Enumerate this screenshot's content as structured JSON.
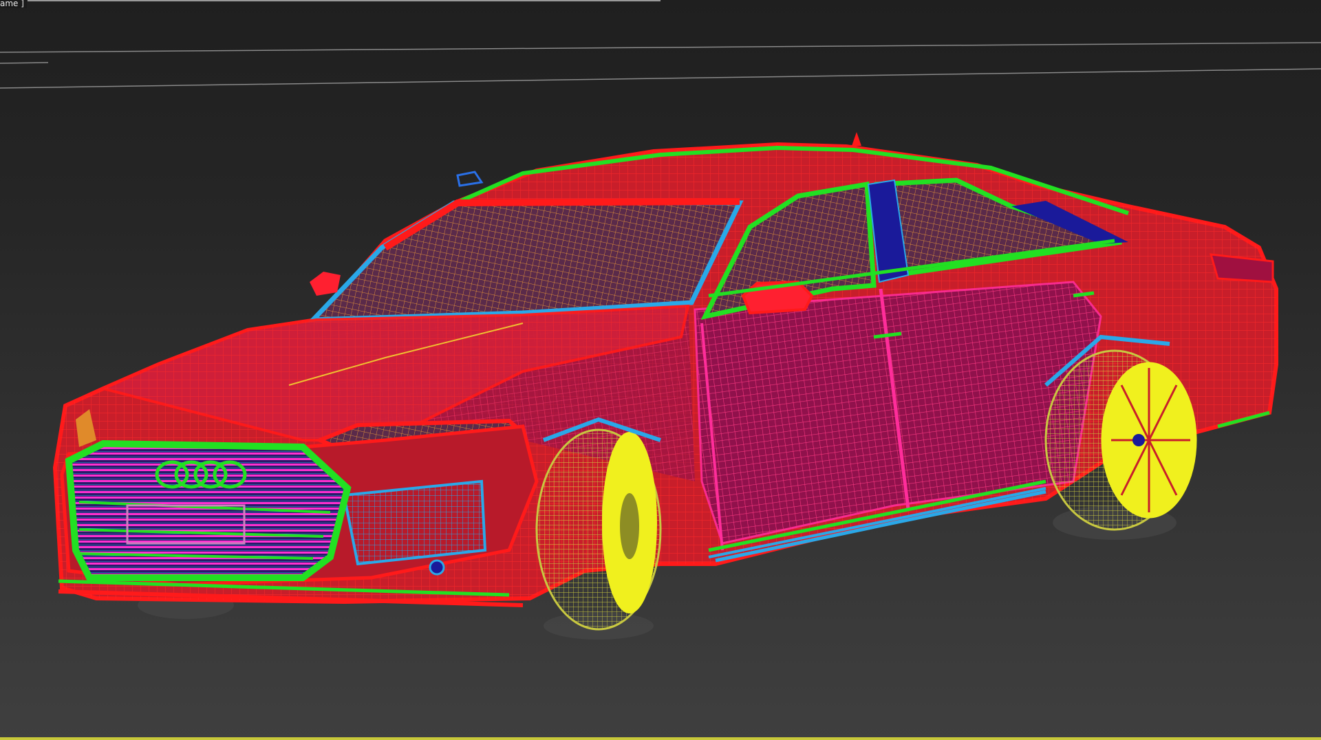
{
  "viewport": {
    "label": "ame ]",
    "display_mode": "wireframe",
    "active_border_color": "#c8c83a",
    "background_top": "#1f1f1f",
    "background_bottom": "#3f3f3f"
  },
  "model": {
    "wire_colors": {
      "body": "#ff1a1a",
      "trim": "#22e022",
      "glass_frame": "#2aa8e8",
      "interior": "#ff2d9a",
      "interior_orange": "#e08a2a",
      "wheels": "#f0f01e",
      "tires": "#d0d030",
      "window_dark": "#1a1a9a",
      "grille": "#ff30d0"
    }
  }
}
